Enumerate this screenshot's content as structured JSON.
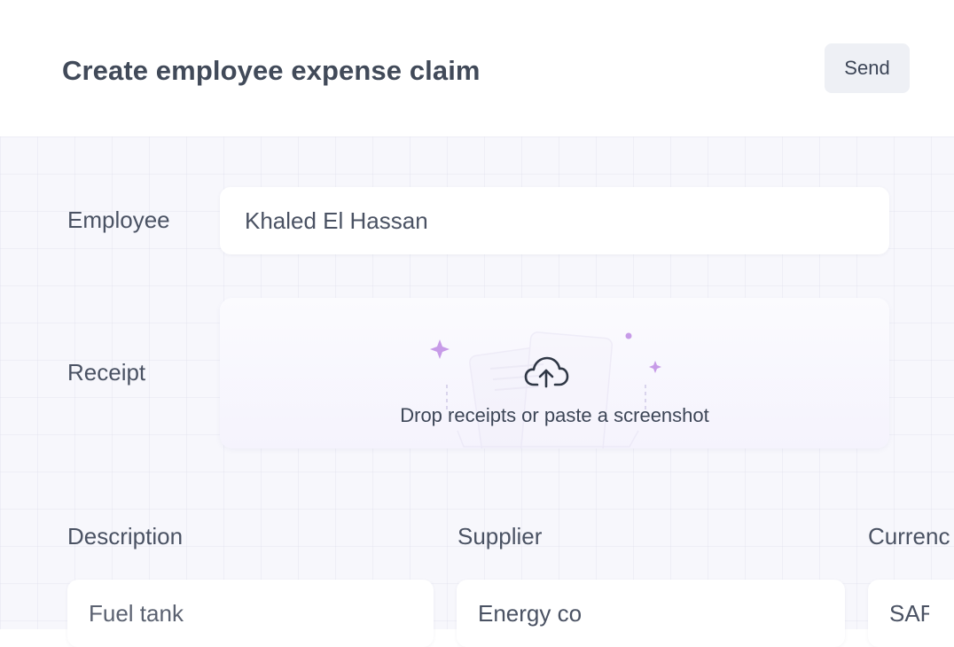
{
  "header": {
    "title": "Create employee expense claim",
    "send_label": "Send"
  },
  "form": {
    "employee": {
      "label": "Employee",
      "value": "Khaled El Hassan"
    },
    "receipt": {
      "label": "Receipt",
      "drop_text": "Drop receipts or paste a screenshot",
      "icon": "upload-cloud-icon"
    },
    "description": {
      "label": "Description",
      "value": "Fuel tank"
    },
    "supplier": {
      "label": "Supplier",
      "value": "Energy co"
    },
    "currency": {
      "label": "Currenc",
      "value": "SAR"
    }
  },
  "colors": {
    "background": "#f7f7fc",
    "field": "#ffffff",
    "button": "#eef0f5",
    "text": "#414a59",
    "sparkle": "#c79be8"
  }
}
